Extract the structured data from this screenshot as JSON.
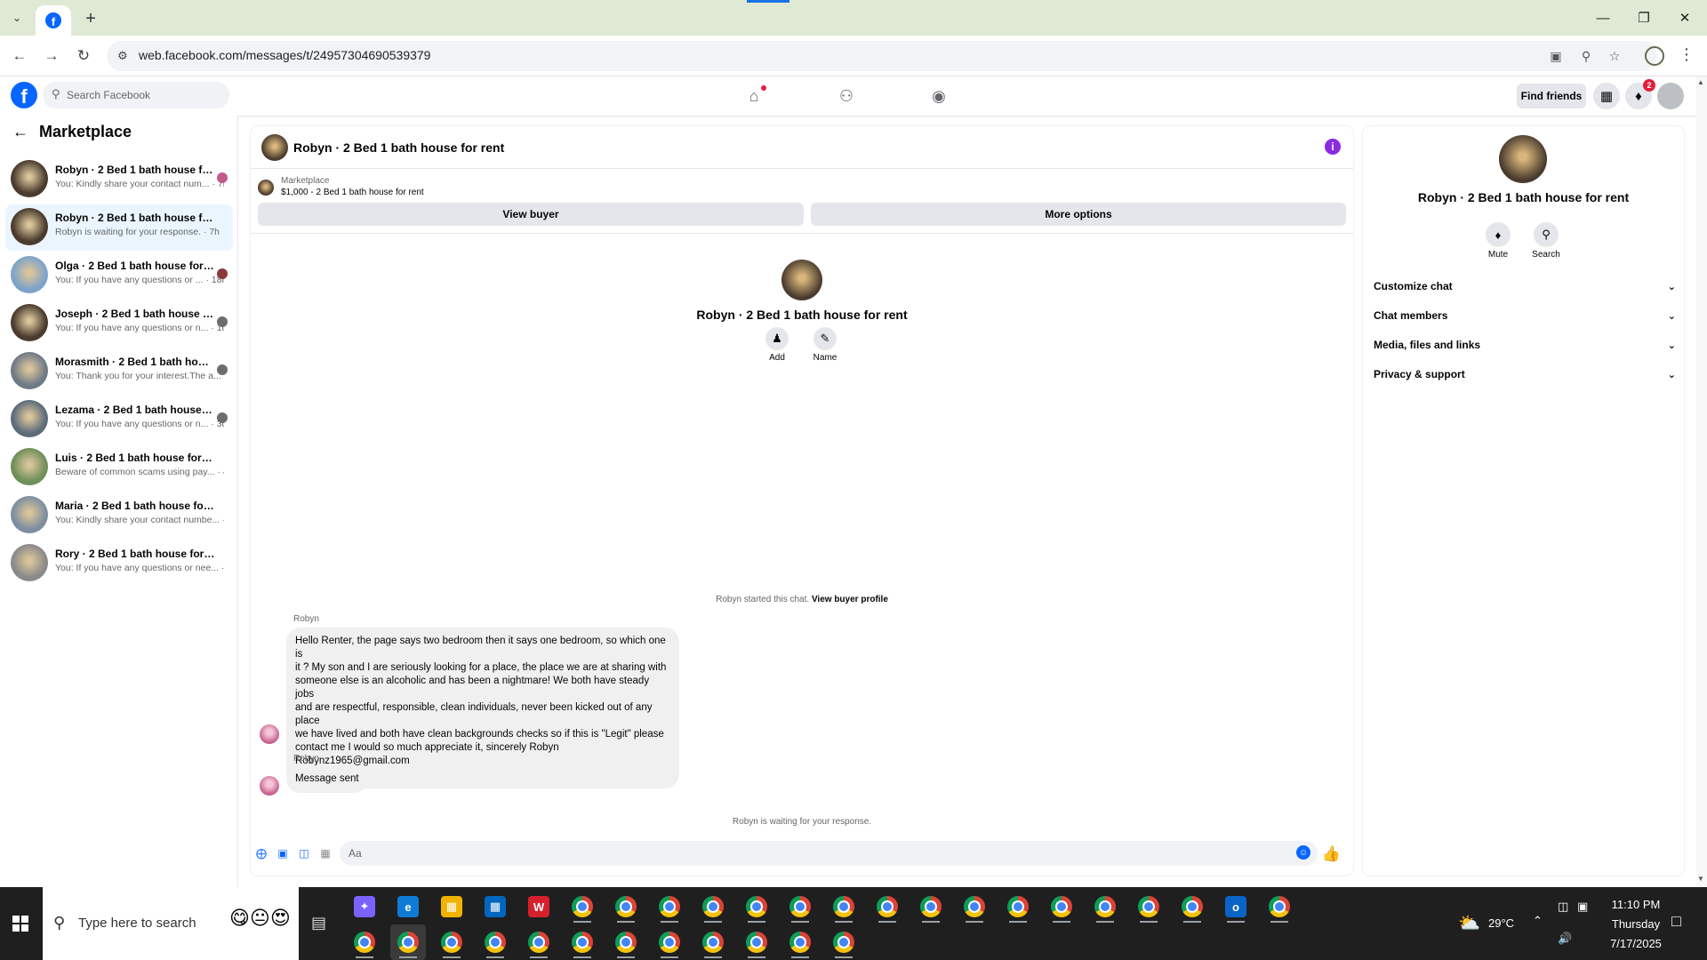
{
  "browser": {
    "url": "web.facebook.com/messages/t/24957304690539379"
  },
  "fb": {
    "search_placeholder": "Search Facebook",
    "find_friends": "Find friends",
    "notif_count": "2"
  },
  "sidebar": {
    "title": "Marketplace",
    "conversations": [
      {
        "title": "Robyn · 2 Bed 1 bath house for r...",
        "preview": "You: Kindly share your contact num... · 7h",
        "thumb": "#4a3b2e"
      },
      {
        "title": "Robyn · 2 Bed 1 bath house for rent",
        "preview": "Robyn is waiting for your response. · 7h",
        "thumb": "#4a3b2e"
      },
      {
        "title": "Olga · 2 Bed 1 bath house for rent",
        "preview": "You: If you have any questions or ... · 18h",
        "thumb": "#7ea3c9"
      },
      {
        "title": "Joseph · 2 Bed 1 bath house for ...",
        "preview": "You: If you have any questions or n... · 1d",
        "thumb": "#4a3b2e"
      },
      {
        "title": "Morasmith · 2 Bed 1 bath house fo...",
        "preview": "You: Thank you for your interest.The a... · 2d",
        "thumb": "#6e7a86"
      },
      {
        "title": "Lezama · 2 Bed 1 bath house for ...",
        "preview": "You: If you have any questions or n... · 3d",
        "thumb": "#5d6b7a"
      },
      {
        "title": "Luis · 2 Bed 1 bath house for rent",
        "preview": "Beware of common scams using pay... · 4d",
        "thumb": "#6f8f5a"
      },
      {
        "title": "Maria · 2 Bed 1 bath house for rent",
        "preview": "You: Kindly share your contact numbe... · 4d",
        "thumb": "#7d8ea0"
      },
      {
        "title": "Rory · 2 Bed 1 bath house for rent",
        "preview": "You: If you have any questions or nee... · 4d",
        "thumb": "#8a8a8a"
      }
    ]
  },
  "chat": {
    "title": "Robyn · 2 Bed 1 bath house for rent",
    "listing_source": "Marketplace",
    "listing_detail": "$1,000 - 2 Bed 1 bath house for rent",
    "view_buyer": "View buyer",
    "more_options": "More options",
    "profile_name": "Robyn · 2 Bed 1 bath house for rent",
    "add_label": "Add",
    "name_label": "Name",
    "started_text": "Robyn started this chat.",
    "view_buyer_profile": "View buyer profile",
    "sender": "Robyn",
    "message1": "Hello Renter, the page says two bedroom then it says one bedroom, so which one is\nit ? My son and I are seriously looking for a place, the place we are at sharing with\nsomeone else is an alcoholic and has been a nightmare! We both have steady jobs\nand are respectful, responsible, clean individuals, never been kicked out of any place\nwe have lived and both have clean backgrounds checks so if this is \"Legit\" please\ncontact me I would so much appreciate it, sincerely Robyn\nRobynz1965@gmail.com\n831-794-3621",
    "message2": "Message sent",
    "waiting": "Robyn is waiting for your response.",
    "composer_placeholder": "Aa"
  },
  "rpanel": {
    "name": "Robyn · 2 Bed 1 bath house for rent",
    "mute": "Mute",
    "search": "Search",
    "sections": [
      "Customize chat",
      "Chat members",
      "Media, files and links",
      "Privacy & support"
    ]
  },
  "taskbar": {
    "search_text": "Type here to search",
    "temperature": "29°C",
    "time": "11:10 PM",
    "day": "Thursday",
    "date": "7/17/2025"
  },
  "colors": {
    "facebook_blue": "#0866ff",
    "tab_strip": "#dfe9d4",
    "active_conversation": "#ebf5ff"
  }
}
